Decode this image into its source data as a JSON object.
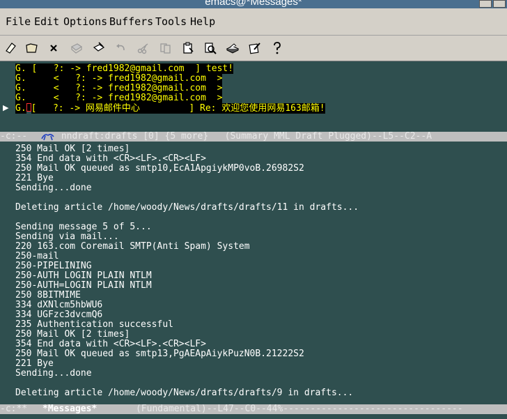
{
  "window": {
    "title": "emacs@*Messages*"
  },
  "menu": [
    "File",
    "Edit",
    "Options",
    "Buffers",
    "Tools",
    "Help"
  ],
  "toolbar_icons": [
    "new-file-icon",
    "open-folder-icon",
    "close-icon",
    "save-icon",
    "save-as-icon",
    "undo-icon",
    "cut-icon",
    "copy-icon",
    "paste-icon",
    "search-icon",
    "print-icon",
    "preferences-icon",
    "help-icon"
  ],
  "summary": {
    "lines": [
      {
        "prefix": "G. [   ?: -> ",
        "text": "G. [   ?: -> fred1982@gmail.com  ] test!"
      },
      {
        "text": "G.     <   ?: -> fred1982@gmail.com  >"
      },
      {
        "text": "G.     <   ?: -> fred1982@gmail.com  >"
      },
      {
        "text": "G.     <   ?: -> fred1982@gmail.com  >"
      },
      {
        "pre": "G.",
        "post": "[   ?: -> 网易邮件中心         ] Re: 欢迎您使用网易163邮箱!"
      }
    ],
    "modeline": "-c:--  ",
    "modeline_rest": " nndraft:drafts [0] {5 more}   (Summary MML Draft Plugged)--L5--C2--A"
  },
  "messages": {
    "lines": [
      "250 Mail OK [2 times]",
      "354 End data with <CR><LF>.<CR><LF>",
      "250 Mail OK queued as smtp10,EcA1ApgiykMP0voB.26982S2",
      "221 Bye",
      "Sending...done",
      "",
      "Deleting article /home/woody/News/drafts/drafts/11 in drafts...",
      "",
      "Sending message 5 of 5...",
      "Sending via mail...",
      "220 163.com Coremail SMTP(Anti Spam) System",
      "250-mail",
      "250-PIPELINING",
      "250-AUTH LOGIN PLAIN NTLM",
      "250-AUTH=LOGIN PLAIN NTLM",
      "250 8BITMIME",
      "334 dXNlcm5hbWU6",
      "334 UGFzc3dvcmQ6",
      "235 Authentication successful",
      "250 Mail OK [2 times]",
      "354 End data with <CR><LF>.<CR><LF>",
      "250 Mail OK queued as smtp13,PgAEApAiykPuzN0B.21222S2",
      "221 Bye",
      "Sending...done",
      "",
      "Deleting article /home/woody/News/drafts/drafts/9 in drafts..."
    ],
    "modeline_prefix": "-c:**  ",
    "buffer_name": "*Messages*",
    "modeline_rest": "      (Fundamental)--L47--C0--44%---------------------------------"
  },
  "colors": {
    "background": "#2f4f4f",
    "summary_highlight_bg": "#000000",
    "summary_highlight_fg": "#ffff00",
    "modeline_bg": "#bebebe",
    "chrome": "#d4d0c8"
  }
}
